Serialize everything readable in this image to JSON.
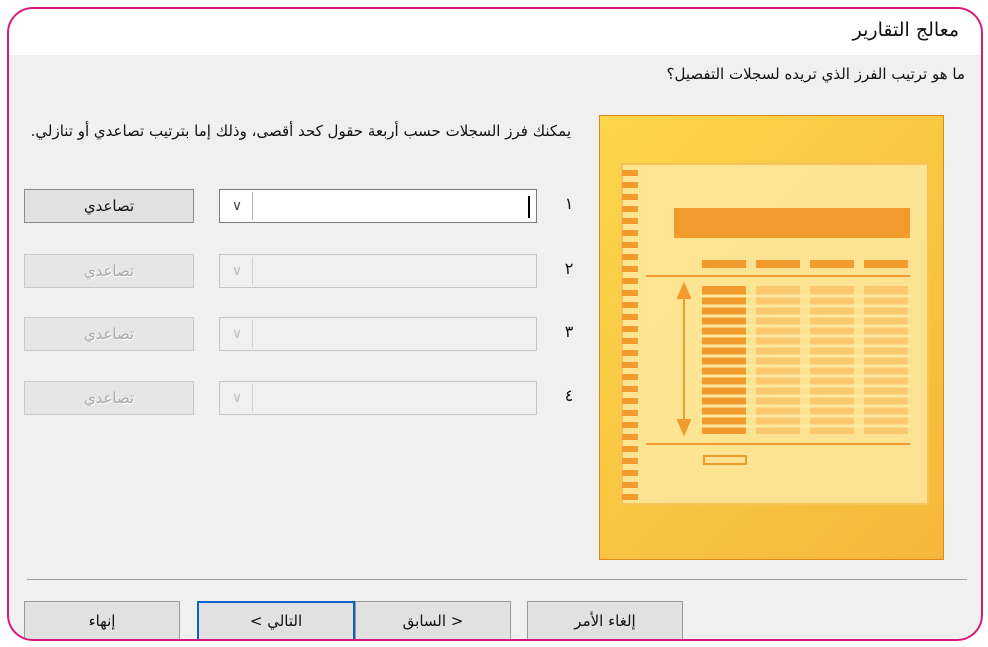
{
  "window": {
    "title": "معالج التقارير"
  },
  "prompt": {
    "question": "ما هو ترتيب الفرز الذي تريده لسجلات التفصيل؟",
    "description": "يمكنك فرز السجلات حسب أربعة حقول كحد أقصى، وذلك إما بترتيب تصاعدي أو تنازلي."
  },
  "sort_rows": [
    {
      "number": "١",
      "field_value": "",
      "order_label": "تصاعدي",
      "enabled": true
    },
    {
      "number": "٢",
      "field_value": "",
      "order_label": "تصاعدي",
      "enabled": false
    },
    {
      "number": "٣",
      "field_value": "",
      "order_label": "تصاعدي",
      "enabled": false
    },
    {
      "number": "٤",
      "field_value": "",
      "order_label": "تصاعدي",
      "enabled": false
    }
  ],
  "buttons": {
    "cancel": "إلغاء الأمر",
    "back": "< السابق",
    "next": "التالي >",
    "finish": "إنهاء"
  },
  "colors": {
    "border_accent": "#d6197a",
    "default_button": "#0a64c8",
    "preview_bg": "#fcd64a",
    "preview_accent": "#f29a2e"
  }
}
